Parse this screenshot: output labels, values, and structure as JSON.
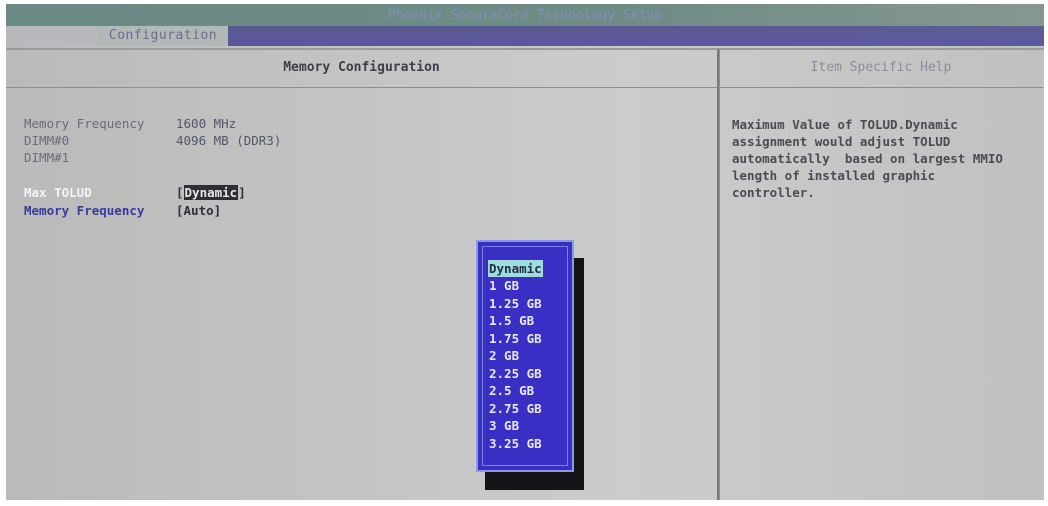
{
  "app": {
    "title": "Phoenix SecureCore Technology Setup",
    "active_tab": "Configuration"
  },
  "main_panel": {
    "header": "Memory Configuration",
    "info": [
      {
        "label": "Memory Frequency",
        "value": "1600 MHz"
      },
      {
        "label": "DIMM#0",
        "value": "4096 MB (DDR3)"
      },
      {
        "label": "DIMM#1",
        "value": ""
      }
    ],
    "options": [
      {
        "label": "Max TOLUD",
        "value": "Dynamic",
        "open_bracket": "[",
        "close_bracket": "]",
        "selected": true
      },
      {
        "label": "Memory Frequency",
        "value": "[Auto]",
        "selected": false
      }
    ]
  },
  "help_panel": {
    "header": "Item Specific Help",
    "text": "Maximum Value of TOLUD.Dynamic\nassignment would adjust TOLUD\nautomatically  based on largest MMIO\nlength of installed graphic\ncontroller."
  },
  "popup": {
    "items": [
      "Dynamic",
      "1 GB",
      "1.25 GB",
      "1.5 GB",
      "1.75 GB",
      "2 GB",
      "2.25 GB",
      "2.5 GB",
      "2.75 GB",
      "3 GB",
      "3.25 GB"
    ],
    "selected": "Dynamic"
  },
  "colors": {
    "popup_bg": "#3a2fc4",
    "popup_highlight": "#9fdcdc",
    "tab_bar": "#5c5796",
    "link_option": "#3b3a9c"
  }
}
